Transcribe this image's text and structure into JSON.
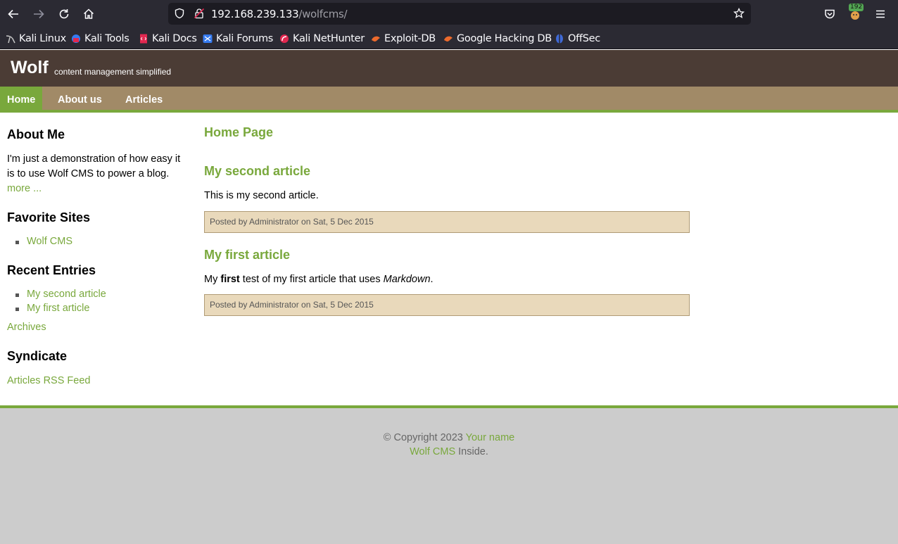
{
  "browser": {
    "url_host": "192.168.239.133",
    "url_path": "/wolfcms/",
    "extension_badge": "192",
    "bookmarks": [
      {
        "label": "Kali Linux",
        "icon": "kali-dragon-icon"
      },
      {
        "label": "Kali Tools",
        "icon": "kali-tools-icon"
      },
      {
        "label": "Kali Docs",
        "icon": "kali-docs-icon"
      },
      {
        "label": "Kali Forums",
        "icon": "kali-forums-icon"
      },
      {
        "label": "Kali NetHunter",
        "icon": "nethunter-icon"
      },
      {
        "label": "Exploit-DB",
        "icon": "exploit-db-icon"
      },
      {
        "label": "Google Hacking DB",
        "icon": "ghdb-icon"
      },
      {
        "label": "OffSec",
        "icon": "offsec-icon"
      }
    ]
  },
  "site": {
    "title": "Wolf",
    "slogan": "content management simplified"
  },
  "nav": {
    "items": [
      {
        "label": "Home",
        "active": true
      },
      {
        "label": "About us",
        "active": false
      },
      {
        "label": "Articles",
        "active": false
      }
    ]
  },
  "sidebar": {
    "about_heading": "About Me",
    "about_text_1": "I'm just a demonstration of how easy it",
    "about_text_2": "is to use Wolf CMS to power a blog.",
    "about_more": "more ...",
    "favorites_heading": "Favorite Sites",
    "favorites": [
      "Wolf CMS"
    ],
    "recent_heading": "Recent Entries",
    "recent": [
      "My second article",
      "My first article"
    ],
    "archives": "Archives",
    "syndicate_heading": "Syndicate",
    "rss": "Articles RSS Feed"
  },
  "content": {
    "page_title": "Home Page",
    "articles": [
      {
        "title": "My second article",
        "body": "This is my second article.",
        "info": "Posted by Administrator on Sat, 5 Dec 2015"
      },
      {
        "title": "My first article",
        "body_pre": "My ",
        "body_bold": "first",
        "body_mid": " test of my first article that uses ",
        "body_em": "Markdown",
        "body_post": ".",
        "info": "Posted by Administrator on Sat, 5 Dec 2015"
      }
    ]
  },
  "footer": {
    "copyright": "© Copyright 2023 ",
    "your_name": "Your name",
    "wolf_cms": "Wolf CMS",
    "inside": " Inside."
  },
  "colors": {
    "header_bg": "#4b3c35",
    "nav_bg": "#a18a67",
    "accent_green": "#79a83c",
    "info_bg": "#e9d9bb",
    "footer_bg": "#cccccc"
  }
}
